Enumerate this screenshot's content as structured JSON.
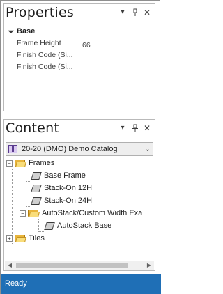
{
  "properties_panel": {
    "title": "Properties",
    "group_label": "Base",
    "rows": [
      {
        "name": "Frame Height",
        "value": "66"
      },
      {
        "name": "Finish Code (Si...",
        "value": ""
      },
      {
        "name": "Finish Code (Si...",
        "value": ""
      }
    ]
  },
  "content_panel": {
    "title": "Content",
    "catalog_selector": "20-20 (DMO) Demo Catalog",
    "tree": {
      "frames": "Frames",
      "base_frame": "Base Frame",
      "stack_on_12h": "Stack-On 12H",
      "stack_on_24h": "Stack-On 24H",
      "autostack_folder": "AutoStack/Custom Width Exa",
      "autostack_base": "AutoStack Base",
      "tiles": "Tiles"
    }
  },
  "status": {
    "text": "Ready"
  },
  "icons": {
    "dropdown": "dropdown-icon",
    "pin": "pin-icon",
    "close": "close-icon",
    "folder": "folder-icon",
    "catalog": "catalog-icon",
    "item": "frame-item-icon"
  },
  "colors": {
    "statusbar": "#1f6fb6",
    "folder": "#e8b43a"
  }
}
